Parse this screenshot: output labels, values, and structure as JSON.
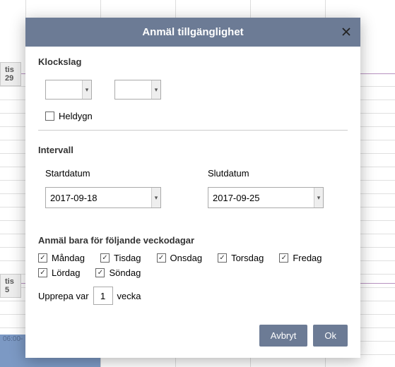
{
  "modal": {
    "title": "Anmäl tillgänglighet",
    "klockslag_label": "Klockslag",
    "time_from": "",
    "time_to": "",
    "heldygn_label": "Heldygn",
    "heldygn_checked": false,
    "intervall_label": "Intervall",
    "startdatum_label": "Startdatum",
    "slutdatum_label": "Slutdatum",
    "startdatum": "2017-09-18",
    "slutdatum": "2017-09-25",
    "weekdays_header": "Anmäl bara för följande veckodagar",
    "weekdays": [
      {
        "label": "Måndag",
        "checked": true
      },
      {
        "label": "Tisdag",
        "checked": true
      },
      {
        "label": "Onsdag",
        "checked": true
      },
      {
        "label": "Torsdag",
        "checked": true
      },
      {
        "label": "Fredag",
        "checked": true
      },
      {
        "label": "Lördag",
        "checked": true
      },
      {
        "label": "Söndag",
        "checked": true
      }
    ],
    "repeat_prefix": "Upprepa var",
    "repeat_value": "1",
    "repeat_suffix": "vecka",
    "cancel_label": "Avbryt",
    "ok_label": "Ok"
  },
  "background": {
    "tab_top": "tis 29",
    "tab_mid": "tis 5",
    "time_label": "06:00-"
  }
}
